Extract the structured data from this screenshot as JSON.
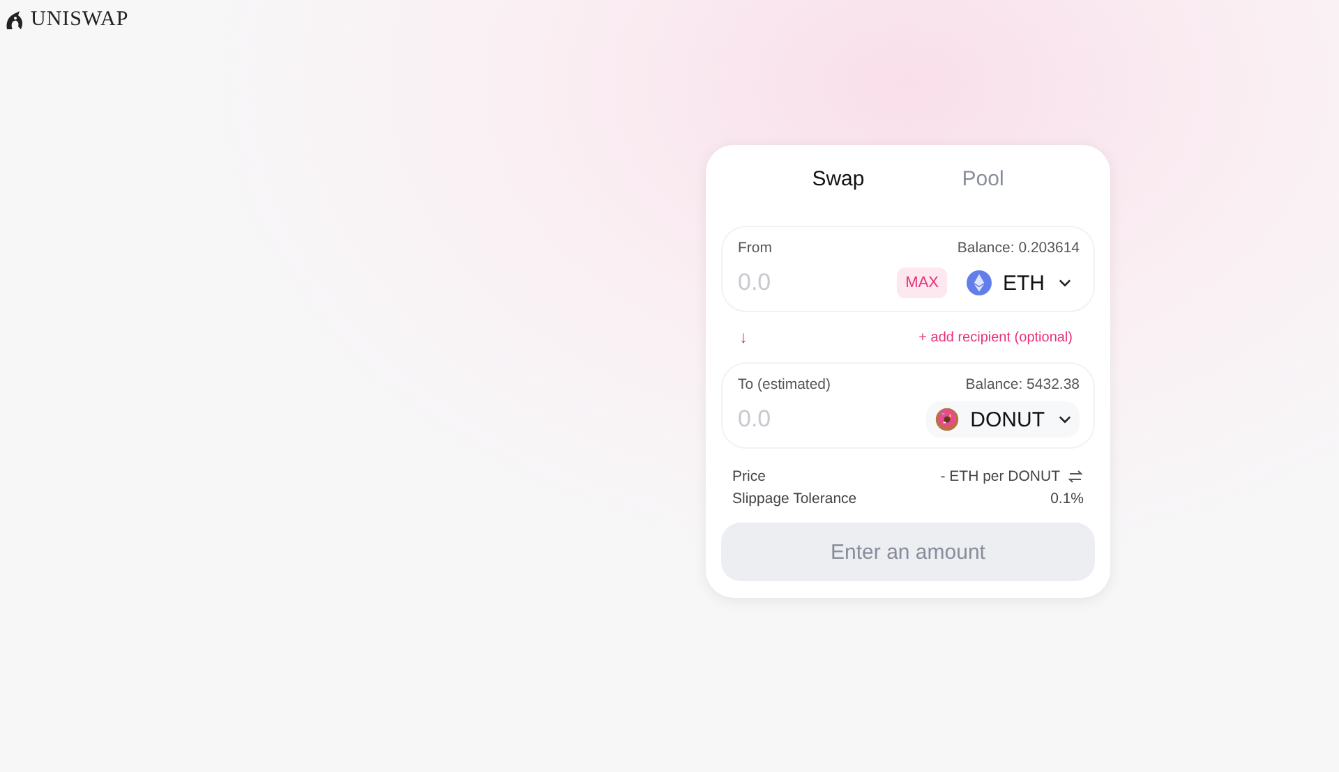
{
  "logo": {
    "text": "UNISWAP"
  },
  "tabs": [
    {
      "label": "Swap",
      "selected": true
    },
    {
      "label": "Pool",
      "selected": false
    }
  ],
  "from": {
    "label": "From",
    "balance": "Balance: 0.203614",
    "placeholder": "0.0",
    "max": "MAX",
    "token": {
      "symbol": "ETH",
      "kind": "eth"
    }
  },
  "arrow": "↓",
  "recipient_link": "+ add recipient (optional)",
  "to": {
    "label": "To (estimated)",
    "balance": "Balance: 5432.38",
    "placeholder": "0.0",
    "token": {
      "symbol": "DONUT",
      "kind": "donut"
    }
  },
  "details": [
    {
      "label": "Price",
      "value": "- ETH per DONUT",
      "swap_icon": true
    },
    {
      "label": "Slippage Tolerance",
      "value": "0.1%",
      "swap_icon": false
    }
  ],
  "action": {
    "label": "Enter an amount",
    "disabled": true
  }
}
